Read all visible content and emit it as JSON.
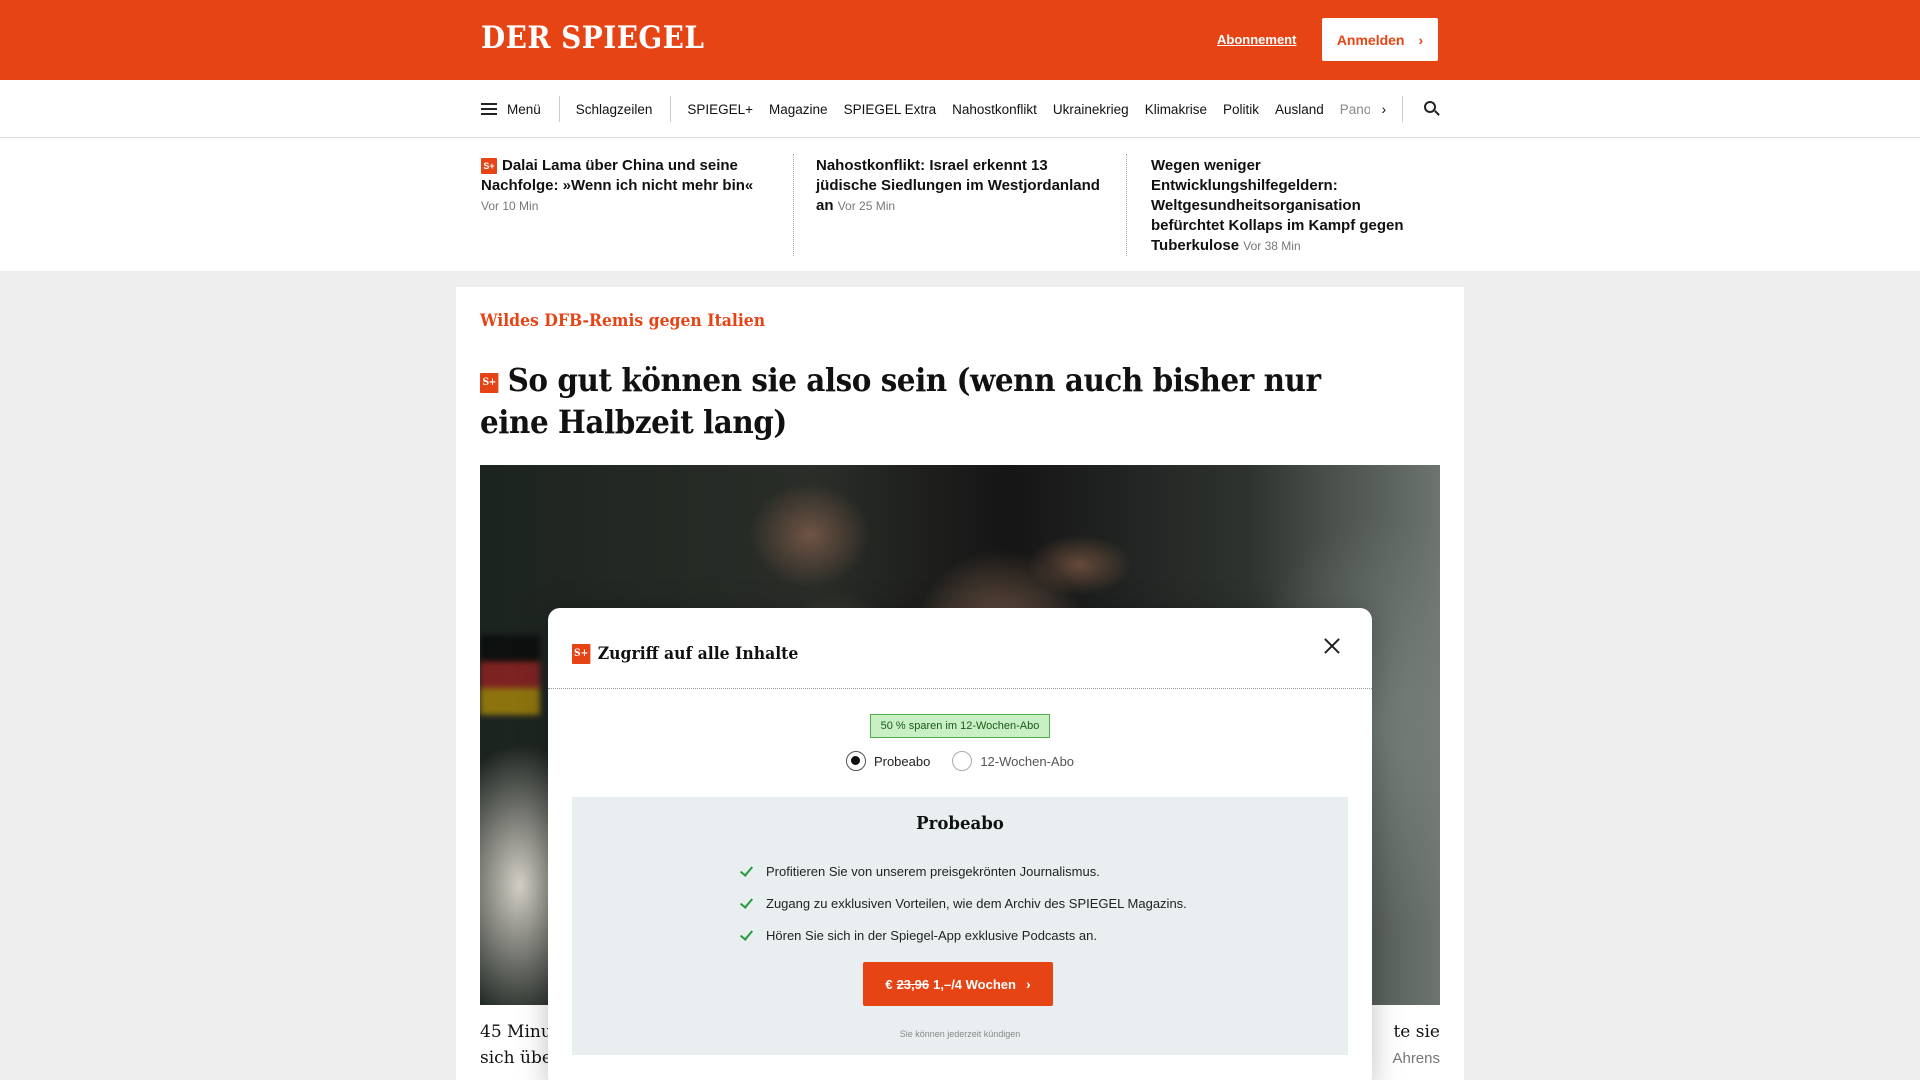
{
  "header": {
    "logo": "DER SPIEGEL",
    "subscription_link": "Abonnement",
    "login_button": "Anmelden",
    "brand_color": "#e64415"
  },
  "nav": {
    "menu_label": "Menü",
    "items": [
      "Schlagzeilen",
      "SPIEGEL+",
      "Magazine",
      "SPIEGEL Extra",
      "Nahostkonflikt",
      "Ukrainekrieg",
      "Klimakrise",
      "Politik",
      "Ausland",
      "Panor"
    ],
    "icons": [
      "hamburger-icon",
      "chevron-right-icon",
      "search-icon"
    ]
  },
  "ticker": [
    {
      "premium": true,
      "title": "Dalai Lama über China und seine Nachfolge: »Wenn ich nicht mehr bin«",
      "time": "Vor 10 Min"
    },
    {
      "premium": false,
      "title": "Nahostkonflikt: Israel erkennt 13 jüdische Siedlungen im Westjordanland an",
      "time": "Vor 25 Min"
    },
    {
      "premium": false,
      "title": "Wegen weniger Entwicklungshilfegeldern: Weltgesundheitsorganisation befürchtet Kollaps im Kampf gegen Tuberkulose",
      "time": "Vor 38 Min"
    }
  ],
  "article": {
    "kicker": "Wildes DFB-Remis gegen Italien",
    "premium_badge": "S+",
    "headline": "So gut können sie also sein (wenn auch bisher nur eine Halbzeit lang)",
    "teaser_left_line1": "45 Minu",
    "teaser_left_line2": "sich über",
    "teaser_right_line1": "te sie",
    "teaser_right_line2": "Ahrens"
  },
  "modal": {
    "badge": "S+",
    "title": "Zugriff auf alle Inhalte",
    "save_badge": "50 % sparen im 12-Wochen-Abo",
    "options": [
      {
        "label": "Probeabo",
        "selected": true
      },
      {
        "label": "12-Wochen-Abo",
        "selected": false
      }
    ],
    "offer": {
      "title": "Probeabo",
      "benefits": [
        "Profitieren Sie von unserem preisgekrönten Journalismus.",
        "Zugang zu exklusiven Vorteilen, wie dem Archiv des SPIEGEL Magazins.",
        "Hören Sie sich in der Spiegel-App exklusive Podcasts an."
      ],
      "cta_currency": "€",
      "cta_old_price": "23,96",
      "cta_new_price": "1,–/4 Wochen",
      "cancel_note": "Sie können jederzeit kündigen"
    }
  }
}
